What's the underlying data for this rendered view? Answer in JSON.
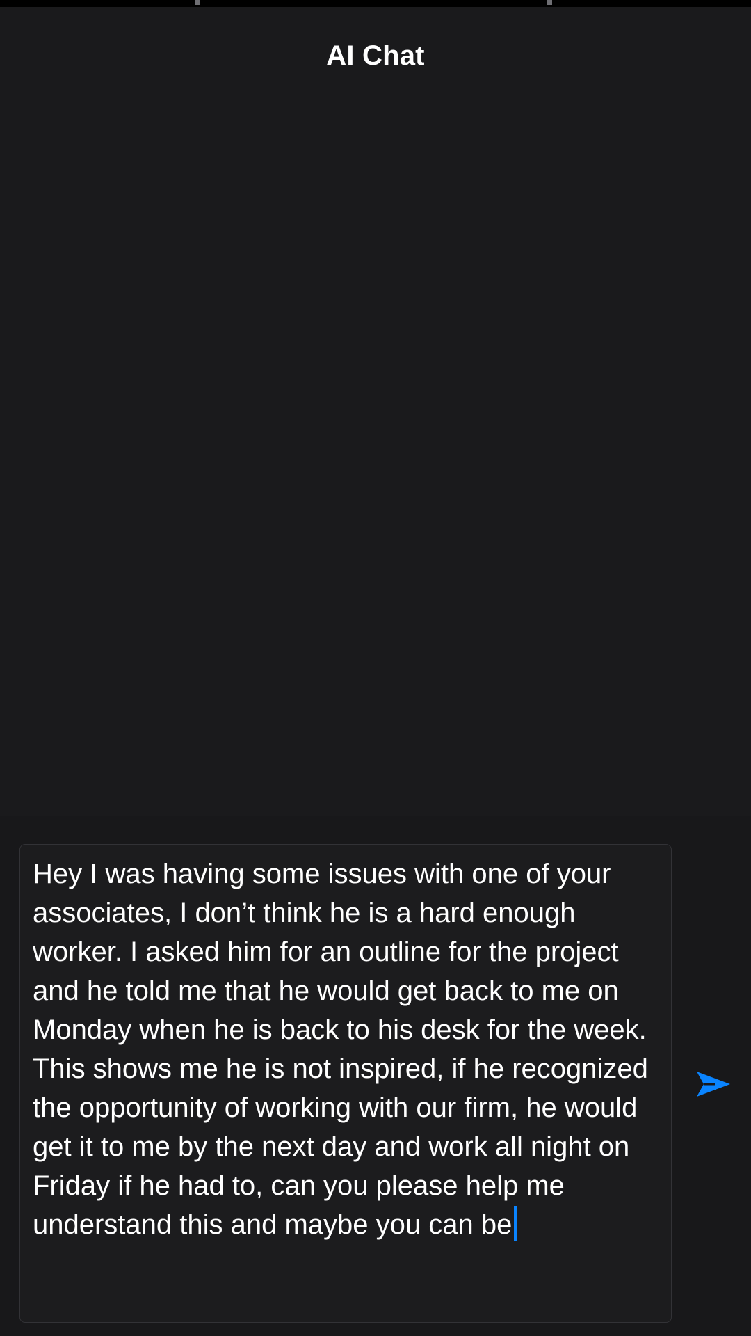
{
  "header": {
    "title": "AI Chat"
  },
  "composer": {
    "input_value": "Hey I was having some issues with one of your associates, I don’t think he is a hard enough worker.  I asked him for an outline for the project and he told me that he would get back to me on Monday when he is back to his desk for the week.  This shows me he is not inspired, if he recognized the opportunity of working with our firm, he would get it to me by the next day and work all night on Friday if he had to, can you please help me understand this and maybe you can be",
    "send_icon": "send-icon"
  },
  "colors": {
    "background": "#1a1a1c",
    "accent": "#0a84ff",
    "text": "#ffffff"
  }
}
